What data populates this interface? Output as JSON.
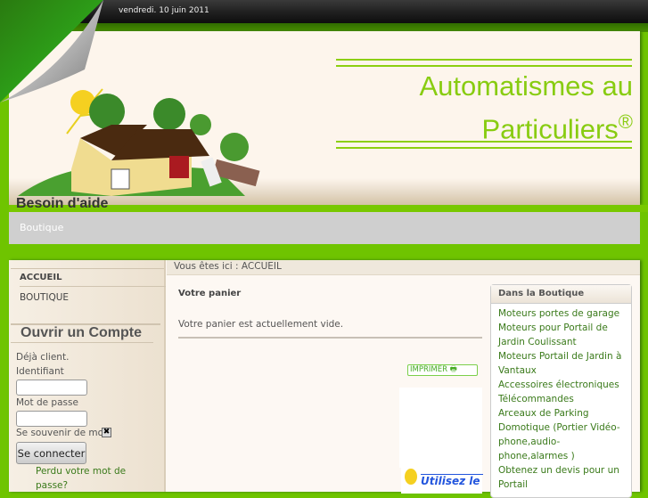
{
  "topbar": {
    "date": "vendredi. 10 juin 2011"
  },
  "header": {
    "title_line1": "Automatismes au",
    "title_line2": "Particuliers",
    "title_mark": "®",
    "help": "Besoin d'aide"
  },
  "nav": {
    "items": [
      {
        "label": "Boutique"
      }
    ]
  },
  "sidebar": {
    "menu": [
      {
        "label": "ACCUEIL"
      },
      {
        "label": "BOUTIQUE"
      }
    ],
    "login": {
      "heading": "Ouvrir un Compte",
      "already": "Déjà client.",
      "user_label": "Identifiant",
      "user_value": "",
      "pass_label": "Mot de passe",
      "pass_value": "",
      "remember": "Se souvenir de moi",
      "remember_mark": "✖",
      "submit": "Se connecter",
      "lost": "Perdu votre mot de passe?"
    }
  },
  "main": {
    "breadcrumb": "Vous êtes ici : ACCUEIL",
    "cart_title": "Votre panier",
    "cart_empty": "Votre panier est actuellement vide.",
    "print": "IMPRIMER",
    "promo": "Utilisez le Z"
  },
  "shop": {
    "heading": "Dans la Boutique",
    "items": [
      "Moteurs portes de garage",
      "Moteurs pour Portail de Jardin Coulissant",
      "Moteurs Portail de Jardin à Vantaux",
      "Accessoires électroniques",
      "Télécommandes",
      "Arceaux de Parking",
      "Domotique (Portier Vidéo-phone,audio-phone,alarmes )",
      "Obtenez un devis pour un Portail"
    ]
  },
  "colors": {
    "green": "#6fc400",
    "title": "#88cc11",
    "link": "#3a7a1a"
  }
}
